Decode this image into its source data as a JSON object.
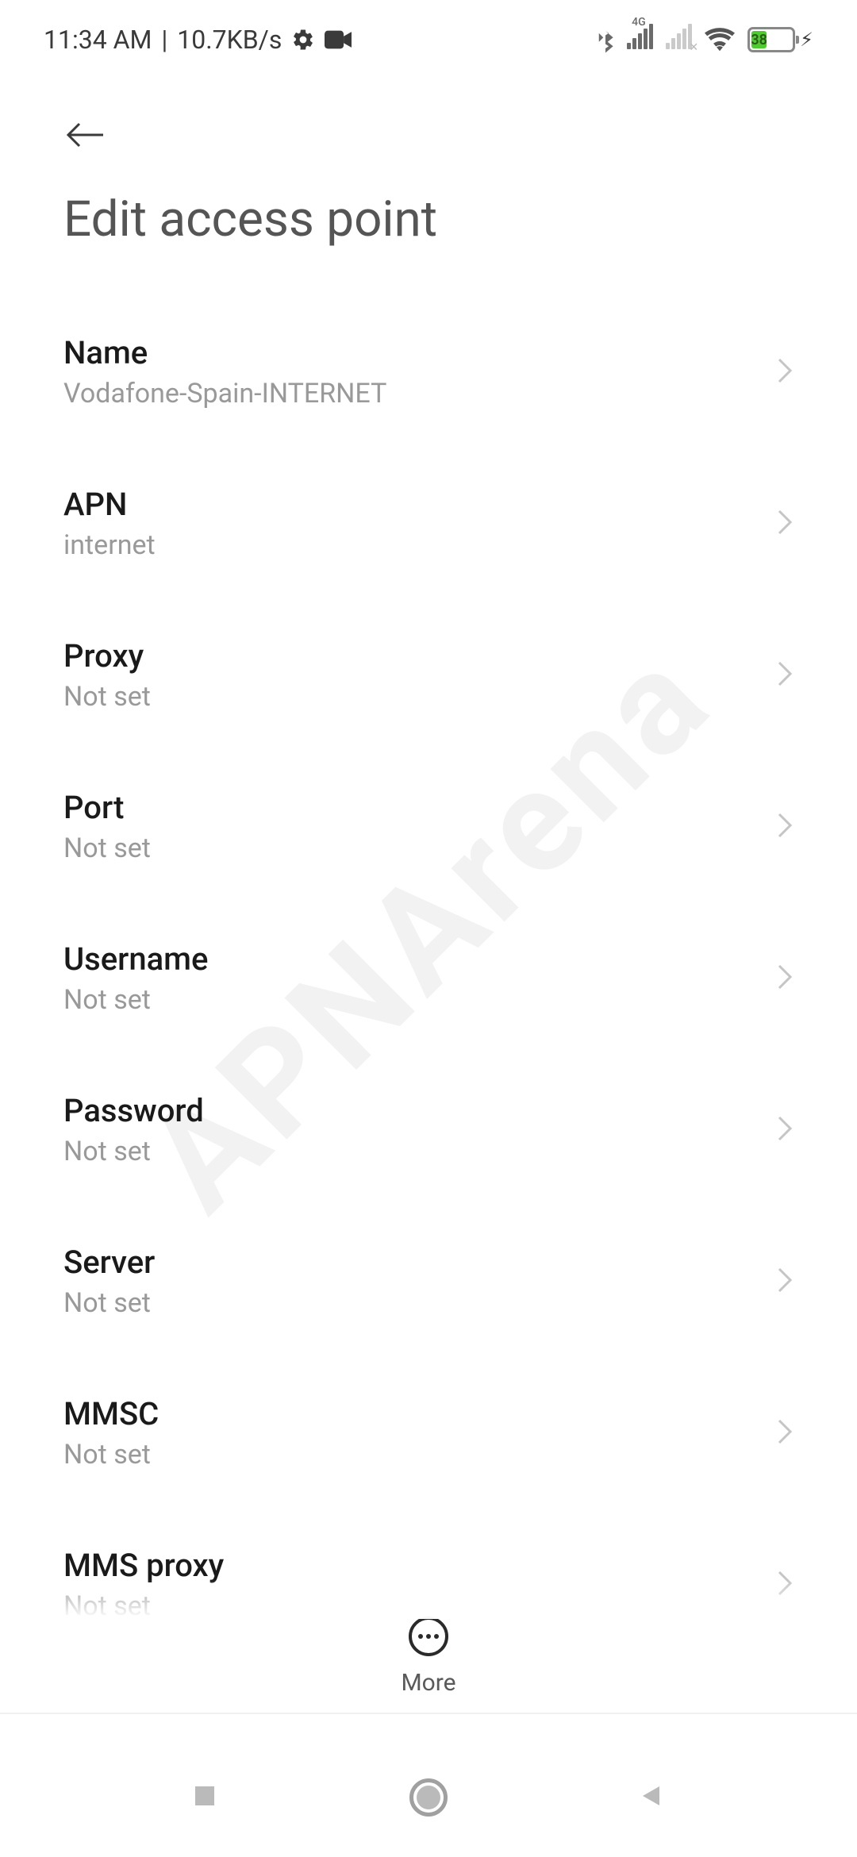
{
  "status": {
    "time": "11:34 AM",
    "speed": "10.7KB/s",
    "network_type": "4G",
    "battery_pct": "38"
  },
  "header": {
    "title": "Edit access point"
  },
  "items": [
    {
      "label": "Name",
      "value": "Vodafone-Spain-INTERNET"
    },
    {
      "label": "APN",
      "value": "internet"
    },
    {
      "label": "Proxy",
      "value": "Not set"
    },
    {
      "label": "Port",
      "value": "Not set"
    },
    {
      "label": "Username",
      "value": "Not set"
    },
    {
      "label": "Password",
      "value": "Not set"
    },
    {
      "label": "Server",
      "value": "Not set"
    },
    {
      "label": "MMSC",
      "value": "Not set"
    },
    {
      "label": "MMS proxy",
      "value": "Not set"
    }
  ],
  "fab": {
    "more_label": "More"
  },
  "watermark": "APNArena"
}
